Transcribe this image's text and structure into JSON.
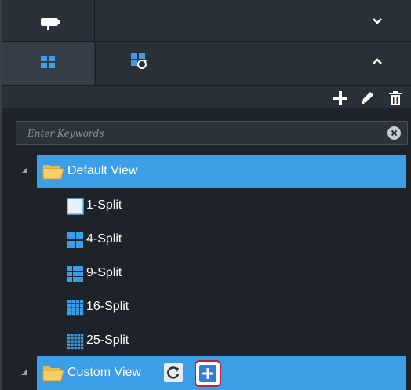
{
  "search": {
    "placeholder": "Enter Keywords"
  },
  "tree": {
    "default_view": {
      "label": "Default View",
      "children": [
        {
          "label": "1-Split",
          "grid": 1
        },
        {
          "label": "4-Split",
          "grid": 2
        },
        {
          "label": "9-Split",
          "grid": 3
        },
        {
          "label": "16-Split",
          "grid": 4
        },
        {
          "label": "25-Split",
          "grid": 5
        }
      ]
    },
    "custom_view": {
      "label": "Custom View"
    }
  },
  "colors": {
    "selection": "#3d9ee8",
    "highlight_ring": "#c0203a",
    "add_button": "#2f7fd8"
  }
}
